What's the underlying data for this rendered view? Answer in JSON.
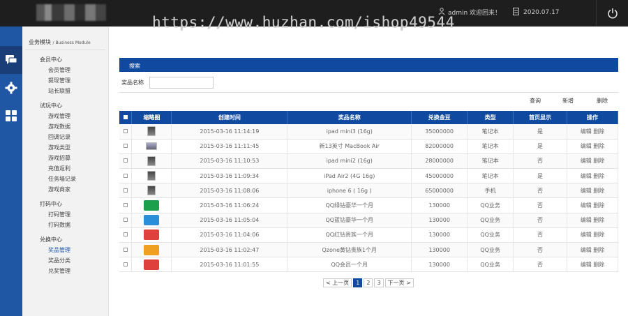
{
  "header": {
    "watermark": "https://www.huzhan.com/ishop49544",
    "welcome": "admin 欢迎回来！",
    "date": "2020.07.17"
  },
  "sidebar": {
    "title": "业务模块",
    "title_en": "/ Business Module",
    "groups": [
      {
        "label": "会员中心",
        "items": [
          "会员管理",
          "提现管理",
          "站长联盟"
        ]
      },
      {
        "label": "试玩中心",
        "items": [
          "游戏管理",
          "游戏数据",
          "回调记录",
          "游戏类型",
          "游戏招募",
          "充值返利",
          "任务墙记录",
          "游戏商家"
        ]
      },
      {
        "label": "打码中心",
        "items": [
          "打码管理",
          "打码数据"
        ]
      },
      {
        "label": "兑换中心",
        "items": [
          "奖品管理",
          "奖品分类",
          "兑奖管理"
        ]
      }
    ],
    "active_item": "奖品管理"
  },
  "panel": {
    "title": "搜索",
    "search_label": "奖品名称",
    "search_value": "",
    "btn_query": "查询",
    "btn_add": "新增",
    "btn_delete": "删除"
  },
  "table": {
    "headers": [
      "缩略图",
      "创建时间",
      "奖品名称",
      "兑换金豆",
      "类型",
      "首页显示",
      "操作"
    ],
    "rows": [
      {
        "thumb": "device",
        "time": "2015-03-16 11:14:19",
        "name": "ipad mini3 (16g)",
        "beans": "35000000",
        "type": "笔记本",
        "show": "是",
        "op": "编辑 删除"
      },
      {
        "thumb": "laptop",
        "time": "2015-03-16 11:11:45",
        "name": "新13英寸 MacBook Air",
        "beans": "82000000",
        "type": "笔记本",
        "show": "是",
        "op": "编辑 删除"
      },
      {
        "thumb": "device",
        "time": "2015-03-16 11:10:53",
        "name": "ipad mini2 (16g)",
        "beans": "28000000",
        "type": "笔记本",
        "show": "否",
        "op": "编辑 删除"
      },
      {
        "thumb": "device",
        "time": "2015-03-16 11:09:34",
        "name": "iPad Air2 (4G 16g)",
        "beans": "45000000",
        "type": "笔记本",
        "show": "是",
        "op": "编辑 删除"
      },
      {
        "thumb": "device",
        "time": "2015-03-16 11:08:06",
        "name": "iphone 6 ( 16g )",
        "beans": "65000000",
        "type": "手机",
        "show": "否",
        "op": "编辑 删除"
      },
      {
        "thumb": "green",
        "time": "2015-03-16 11:06:24",
        "name": "QQ绿钻豪华一个月",
        "beans": "130000",
        "type": "QQ业务",
        "show": "否",
        "op": "编辑 删除"
      },
      {
        "thumb": "blue",
        "time": "2015-03-16 11:05:04",
        "name": "QQ蓝钻豪华一个月",
        "beans": "130000",
        "type": "QQ业务",
        "show": "否",
        "op": "编辑 删除"
      },
      {
        "thumb": "red",
        "time": "2015-03-16 11:04:06",
        "name": "QQ红钻贵族一个月",
        "beans": "130000",
        "type": "QQ业务",
        "show": "否",
        "op": "编辑 删除"
      },
      {
        "thumb": "yellow",
        "time": "2015-03-16 11:02:47",
        "name": "Qzone黄钻贵族1个月",
        "beans": "130000",
        "type": "QQ业务",
        "show": "否",
        "op": "编辑 删除"
      },
      {
        "thumb": "red",
        "time": "2015-03-16 11:01:55",
        "name": "QQ会员一个月",
        "beans": "130000",
        "type": "QQ业务",
        "show": "否",
        "op": "编辑 删除"
      }
    ]
  },
  "pager": {
    "prev": "< 上一页",
    "pages": [
      "1",
      "2",
      "3"
    ],
    "current": "1",
    "next": "下一页 >"
  },
  "colors": {
    "primary": "#0f4aa0",
    "iconbar": "#2057a5",
    "topbar": "#1e1e1e"
  }
}
